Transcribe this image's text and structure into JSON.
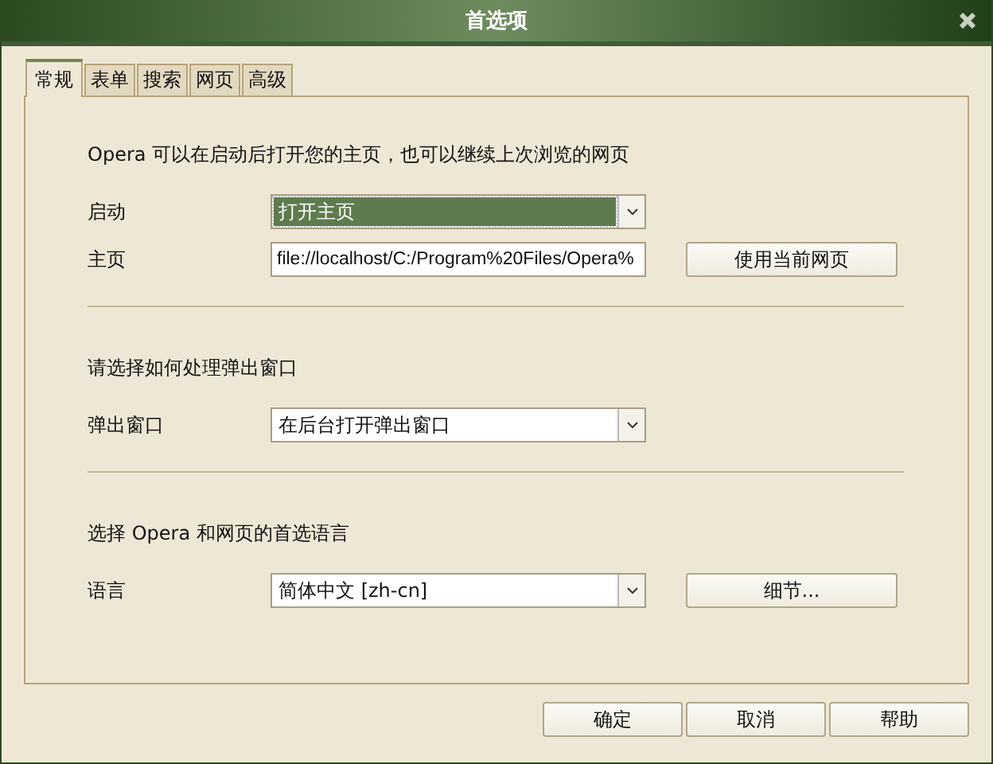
{
  "window": {
    "title": "首选项"
  },
  "tabs": [
    {
      "label": "常规",
      "selected": true
    },
    {
      "label": "表单",
      "selected": false
    },
    {
      "label": "搜索",
      "selected": false
    },
    {
      "label": "网页",
      "selected": false
    },
    {
      "label": "高级",
      "selected": false
    }
  ],
  "sections": [
    {
      "heading": "Opera 可以在启动后打开您的主页，也可以继续上次浏览的网页",
      "rows": [
        {
          "label": "启动",
          "kind": "dropdown",
          "value": "打开主页",
          "selected": true
        },
        {
          "label": "主页",
          "kind": "text",
          "value": "file://localhost/C:/Program%20Files/Opera%",
          "selected": false,
          "button": "使用当前网页"
        }
      ]
    },
    {
      "heading": "请选择如何处理弹出窗口",
      "rows": [
        {
          "label": "弹出窗口",
          "kind": "dropdown",
          "value": "在后台打开弹出窗口",
          "selected": false
        }
      ]
    },
    {
      "heading": "选择 Opera 和网页的首选语言",
      "rows": [
        {
          "label": "语言",
          "kind": "dropdown",
          "value": "简体中文 [zh-cn]",
          "selected": false,
          "button": "细节..."
        }
      ]
    }
  ],
  "buttons": [
    "确定",
    "取消",
    "帮助"
  ]
}
